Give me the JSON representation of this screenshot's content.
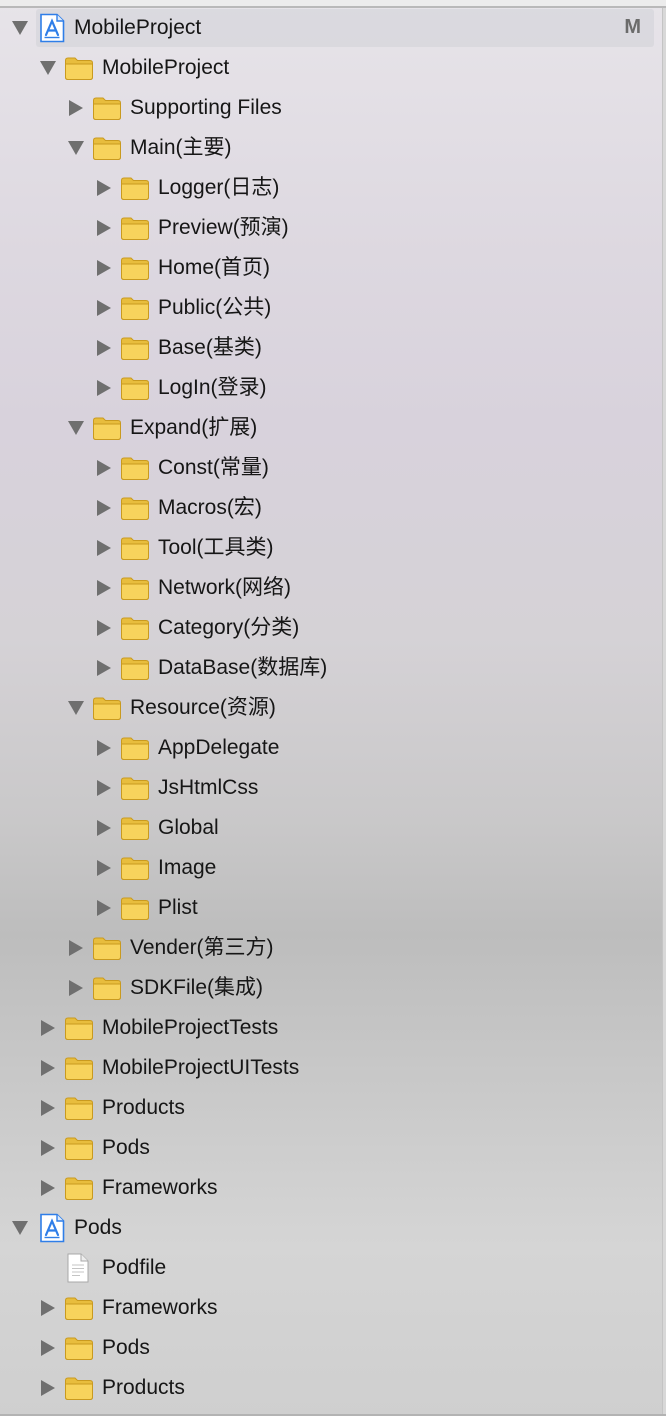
{
  "tree": {
    "items": [
      {
        "label": "MobileProject",
        "icon": "xcode-project-icon",
        "depth": 0,
        "state": "expanded",
        "selected": true,
        "badge": "M"
      },
      {
        "label": "MobileProject",
        "icon": "folder-icon",
        "depth": 1,
        "state": "expanded"
      },
      {
        "label": "Supporting Files",
        "icon": "folder-icon",
        "depth": 2,
        "state": "collapsed"
      },
      {
        "label": "Main(主要)",
        "icon": "folder-icon",
        "depth": 2,
        "state": "expanded"
      },
      {
        "label": "Logger(日志)",
        "icon": "folder-icon",
        "depth": 3,
        "state": "collapsed"
      },
      {
        "label": "Preview(预演)",
        "icon": "folder-icon",
        "depth": 3,
        "state": "collapsed"
      },
      {
        "label": "Home(首页)",
        "icon": "folder-icon",
        "depth": 3,
        "state": "collapsed"
      },
      {
        "label": "Public(公共)",
        "icon": "folder-icon",
        "depth": 3,
        "state": "collapsed"
      },
      {
        "label": "Base(基类)",
        "icon": "folder-icon",
        "depth": 3,
        "state": "collapsed"
      },
      {
        "label": "LogIn(登录)",
        "icon": "folder-icon",
        "depth": 3,
        "state": "collapsed"
      },
      {
        "label": "Expand(扩展)",
        "icon": "folder-icon",
        "depth": 2,
        "state": "expanded"
      },
      {
        "label": "Const(常量)",
        "icon": "folder-icon",
        "depth": 3,
        "state": "collapsed"
      },
      {
        "label": "Macros(宏)",
        "icon": "folder-icon",
        "depth": 3,
        "state": "collapsed"
      },
      {
        "label": "Tool(工具类)",
        "icon": "folder-icon",
        "depth": 3,
        "state": "collapsed"
      },
      {
        "label": "Network(网络)",
        "icon": "folder-icon",
        "depth": 3,
        "state": "collapsed"
      },
      {
        "label": "Category(分类)",
        "icon": "folder-icon",
        "depth": 3,
        "state": "collapsed"
      },
      {
        "label": "DataBase(数据库)",
        "icon": "folder-icon",
        "depth": 3,
        "state": "collapsed"
      },
      {
        "label": "Resource(资源)",
        "icon": "folder-icon",
        "depth": 2,
        "state": "expanded"
      },
      {
        "label": "AppDelegate",
        "icon": "folder-icon",
        "depth": 3,
        "state": "collapsed"
      },
      {
        "label": "JsHtmlCss",
        "icon": "folder-icon",
        "depth": 3,
        "state": "collapsed"
      },
      {
        "label": "Global",
        "icon": "folder-icon",
        "depth": 3,
        "state": "collapsed"
      },
      {
        "label": "Image",
        "icon": "folder-icon",
        "depth": 3,
        "state": "collapsed"
      },
      {
        "label": "Plist",
        "icon": "folder-icon",
        "depth": 3,
        "state": "collapsed"
      },
      {
        "label": "Vender(第三方)",
        "icon": "folder-icon",
        "depth": 2,
        "state": "collapsed"
      },
      {
        "label": "SDKFile(集成)",
        "icon": "folder-icon",
        "depth": 2,
        "state": "collapsed"
      },
      {
        "label": "MobileProjectTests",
        "icon": "folder-icon",
        "depth": 1,
        "state": "collapsed"
      },
      {
        "label": "MobileProjectUITests",
        "icon": "folder-icon",
        "depth": 1,
        "state": "collapsed"
      },
      {
        "label": "Products",
        "icon": "folder-icon",
        "depth": 1,
        "state": "collapsed"
      },
      {
        "label": "Pods",
        "icon": "folder-icon",
        "depth": 1,
        "state": "collapsed"
      },
      {
        "label": "Frameworks",
        "icon": "folder-icon",
        "depth": 1,
        "state": "collapsed"
      },
      {
        "label": "Pods",
        "icon": "xcode-project-icon",
        "depth": 0,
        "state": "expanded"
      },
      {
        "label": "Podfile",
        "icon": "document-icon",
        "depth": 1,
        "state": "leaf"
      },
      {
        "label": "Frameworks",
        "icon": "folder-icon",
        "depth": 1,
        "state": "collapsed"
      },
      {
        "label": "Pods",
        "icon": "folder-icon",
        "depth": 1,
        "state": "collapsed"
      },
      {
        "label": "Products",
        "icon": "folder-icon",
        "depth": 1,
        "state": "collapsed"
      }
    ]
  },
  "colors": {
    "folder_body": "#f7d35c",
    "folder_tab": "#e8bd3d",
    "folder_outline": "#c99a1f",
    "project_blue": "#2f7ee8",
    "disclosure": "#6f6f6f",
    "text": "#161616",
    "selection": "#d6d6db",
    "badge": "#6b6b6b"
  }
}
